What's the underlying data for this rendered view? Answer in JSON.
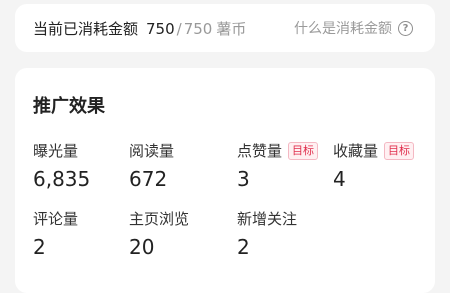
{
  "spending": {
    "label": "当前已消耗金额",
    "used": "750",
    "separator": "/",
    "total": "750",
    "unit": "薯币",
    "help_text": "什么是消耗金额",
    "help_icon": "question-circle-icon"
  },
  "promotion": {
    "title": "推广效果",
    "target_tag": "目标",
    "metrics": [
      {
        "label": "曝光量",
        "value": "6,835"
      },
      {
        "label": "阅读量",
        "value": "672"
      },
      {
        "label": "点赞量",
        "value": "3"
      },
      {
        "label": "收藏量",
        "value": "4"
      },
      {
        "label": "评论量",
        "value": "2"
      },
      {
        "label": "主页浏览",
        "value": "20"
      },
      {
        "label": "新增关注",
        "value": "2"
      }
    ]
  },
  "colors": {
    "background": "#f4f4f4",
    "card": "#ffffff",
    "tag_text": "#e0304e",
    "tag_bg": "#fff0f2",
    "muted_text": "#999999"
  }
}
